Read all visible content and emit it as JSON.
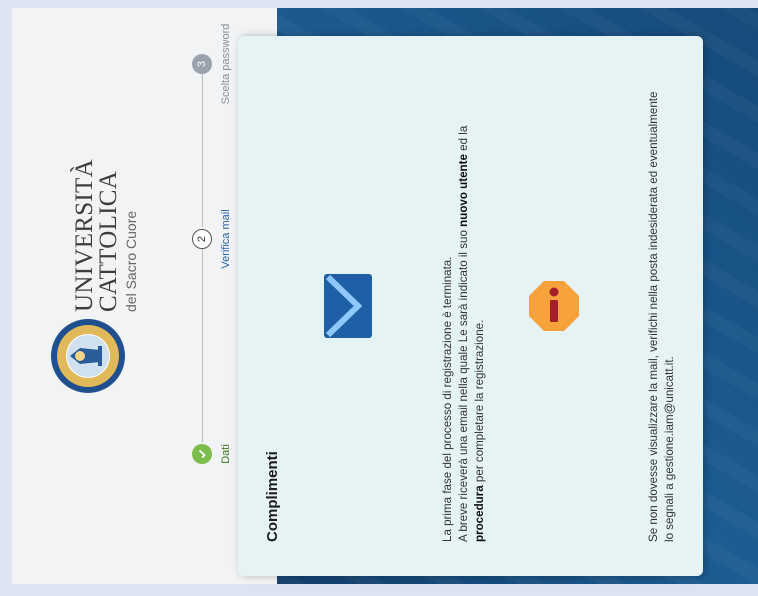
{
  "brand": {
    "line1": "UNIVERSITÀ",
    "line2": "CATTOLICA",
    "line3": "del Sacro Cuore"
  },
  "steps": [
    {
      "number": "",
      "label": "Dati",
      "state": "done"
    },
    {
      "number": "2",
      "label": "Verifica mail",
      "state": "active"
    },
    {
      "number": "3",
      "label": "Scelta password",
      "state": "pending"
    }
  ],
  "card": {
    "title": "Complimenti",
    "line1": "La prima fase del processo di registrazione è terminata.",
    "line2_a": "A breve riceverà una email nella quale Le sarà indicato il suo ",
    "line2_b": "nuovo utente",
    "line2_c": " ed la",
    "line3_a": "procedura",
    "line3_b": " per completare la registrazione.",
    "line4": "Se non dovesse visualizzare la mail, verifichi nella posta indesiderata ed eventualmente",
    "line5": "lo segnali a gestione.iam@unicatt.it."
  },
  "icons": {
    "mail": "mail-icon",
    "warning": "warning-icon",
    "check": "check-icon"
  },
  "colors": {
    "mail_blue": "#1f5fa5",
    "warning": "#f7a23a",
    "done_green": "#7cbc4a",
    "active_blue": "#2b62a8"
  }
}
